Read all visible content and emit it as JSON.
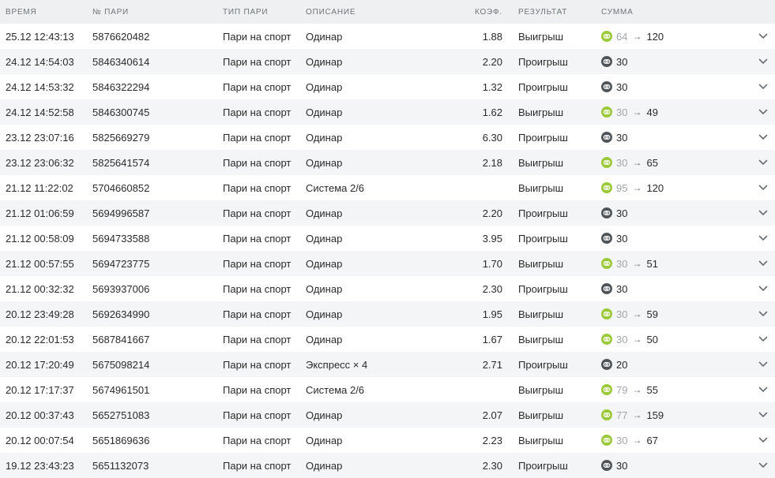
{
  "headers": {
    "time": "ВРЕМЯ",
    "bet_id": "№ ПАРИ",
    "type": "ТИП ПАРИ",
    "desc": "ОПИСАНИЕ",
    "coef": "КОЭФ.",
    "result": "РЕЗУЛЬТАТ",
    "sum": "СУММА"
  },
  "colors": {
    "win_coin": "#9cc93a",
    "loss_coin": "#505559",
    "row_alt_bg": "#f3f5f7",
    "header_bg": "#eef0f2"
  },
  "icons": {
    "coin": "coin-icon",
    "arrow": "arrow-right-icon",
    "expand": "chevron-down-icon"
  },
  "rows": [
    {
      "time": "25.12 12:43:13",
      "id": "5876620482",
      "type": "Пари на спорт",
      "desc": "Одинар",
      "coef": "1.88",
      "result": "Выигрыш",
      "win": true,
      "stake": "64",
      "arrow": "→",
      "payout": "120"
    },
    {
      "time": "24.12 14:54:03",
      "id": "5846340614",
      "type": "Пари на спорт",
      "desc": "Одинар",
      "coef": "2.20",
      "result": "Проигрыш",
      "win": false,
      "stake": "30",
      "arrow": "",
      "payout": ""
    },
    {
      "time": "24.12 14:53:32",
      "id": "5846322294",
      "type": "Пари на спорт",
      "desc": "Одинар",
      "coef": "1.32",
      "result": "Проигрыш",
      "win": false,
      "stake": "30",
      "arrow": "",
      "payout": ""
    },
    {
      "time": "24.12 14:52:58",
      "id": "5846300745",
      "type": "Пари на спорт",
      "desc": "Одинар",
      "coef": "1.62",
      "result": "Выигрыш",
      "win": true,
      "stake": "30",
      "arrow": "→",
      "payout": "49"
    },
    {
      "time": "23.12 23:07:16",
      "id": "5825669279",
      "type": "Пари на спорт",
      "desc": "Одинар",
      "coef": "6.30",
      "result": "Проигрыш",
      "win": false,
      "stake": "30",
      "arrow": "",
      "payout": ""
    },
    {
      "time": "23.12 23:06:32",
      "id": "5825641574",
      "type": "Пари на спорт",
      "desc": "Одинар",
      "coef": "2.18",
      "result": "Выигрыш",
      "win": true,
      "stake": "30",
      "arrow": "→",
      "payout": "65"
    },
    {
      "time": "21.12 11:22:02",
      "id": "5704660852",
      "type": "Пари на спорт",
      "desc": "Система 2/6",
      "coef": "",
      "result": "Выигрыш",
      "win": true,
      "stake": "95",
      "arrow": "→",
      "payout": "120"
    },
    {
      "time": "21.12 01:06:59",
      "id": "5694996587",
      "type": "Пари на спорт",
      "desc": "Одинар",
      "coef": "2.20",
      "result": "Проигрыш",
      "win": false,
      "stake": "30",
      "arrow": "",
      "payout": ""
    },
    {
      "time": "21.12 00:58:09",
      "id": "5694733588",
      "type": "Пари на спорт",
      "desc": "Одинар",
      "coef": "3.95",
      "result": "Проигрыш",
      "win": false,
      "stake": "30",
      "arrow": "",
      "payout": ""
    },
    {
      "time": "21.12 00:57:55",
      "id": "5694723775",
      "type": "Пари на спорт",
      "desc": "Одинар",
      "coef": "1.70",
      "result": "Выигрыш",
      "win": true,
      "stake": "30",
      "arrow": "→",
      "payout": "51"
    },
    {
      "time": "21.12 00:32:32",
      "id": "5693937006",
      "type": "Пари на спорт",
      "desc": "Одинар",
      "coef": "2.30",
      "result": "Проигрыш",
      "win": false,
      "stake": "30",
      "arrow": "",
      "payout": ""
    },
    {
      "time": "20.12 23:49:28",
      "id": "5692634990",
      "type": "Пари на спорт",
      "desc": "Одинар",
      "coef": "1.95",
      "result": "Выигрыш",
      "win": true,
      "stake": "30",
      "arrow": "→",
      "payout": "59"
    },
    {
      "time": "20.12 22:01:53",
      "id": "5687841667",
      "type": "Пари на спорт",
      "desc": "Одинар",
      "coef": "1.67",
      "result": "Выигрыш",
      "win": true,
      "stake": "30",
      "arrow": "→",
      "payout": "50"
    },
    {
      "time": "20.12 17:20:49",
      "id": "5675098214",
      "type": "Пари на спорт",
      "desc": "Экспресс × 4",
      "coef": "2.71",
      "result": "Проигрыш",
      "win": false,
      "stake": "20",
      "arrow": "",
      "payout": ""
    },
    {
      "time": "20.12 17:17:37",
      "id": "5674961501",
      "type": "Пари на спорт",
      "desc": "Система 2/6",
      "coef": "",
      "result": "Выигрыш",
      "win": true,
      "stake": "79",
      "arrow": "→",
      "payout": "55"
    },
    {
      "time": "20.12 00:37:43",
      "id": "5652751083",
      "type": "Пари на спорт",
      "desc": "Одинар",
      "coef": "2.07",
      "result": "Выигрыш",
      "win": true,
      "stake": "77",
      "arrow": "→",
      "payout": "159"
    },
    {
      "time": "20.12 00:07:54",
      "id": "5651869636",
      "type": "Пари на спорт",
      "desc": "Одинар",
      "coef": "2.23",
      "result": "Выигрыш",
      "win": true,
      "stake": "30",
      "arrow": "→",
      "payout": "67"
    },
    {
      "time": "19.12 23:43:23",
      "id": "5651132073",
      "type": "Пари на спорт",
      "desc": "Одинар",
      "coef": "2.30",
      "result": "Проигрыш",
      "win": false,
      "stake": "30",
      "arrow": "",
      "payout": ""
    }
  ]
}
